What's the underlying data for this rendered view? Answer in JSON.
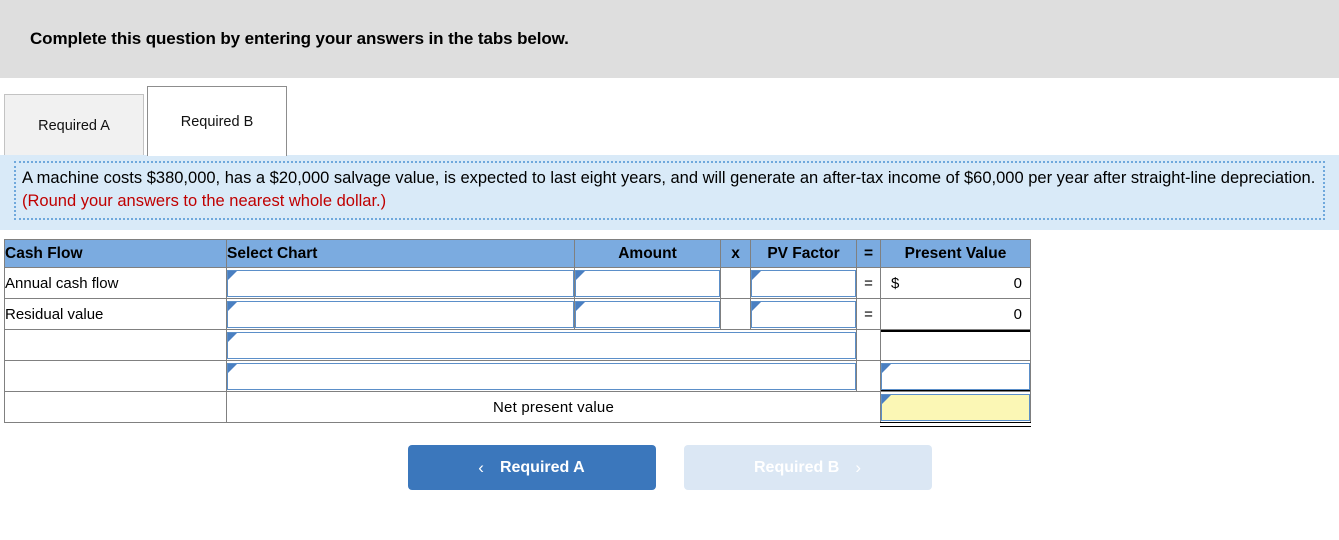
{
  "banner": {
    "instruction": "Complete this question by entering your answers in the tabs below."
  },
  "tabs": [
    {
      "label": "Required A",
      "active": false
    },
    {
      "label": "Required B",
      "active": true
    }
  ],
  "question": {
    "text": "A machine costs $380,000, has a $20,000 salvage value, is expected to last eight years, and will generate an after-tax income of $60,000 per year after straight-line depreciation.",
    "note": "(Round your answers to the nearest whole dollar.)"
  },
  "table": {
    "headers": {
      "cash_flow": "Cash Flow",
      "select_chart": "Select Chart",
      "amount": "Amount",
      "times": "x",
      "pv_factor": "PV Factor",
      "equals": "=",
      "present_value": "Present Value"
    },
    "rows": [
      {
        "cash_flow": "Annual cash flow",
        "select_chart": "",
        "amount": "",
        "times": "",
        "pv_factor": "",
        "equals": "=",
        "pv_currency": "$",
        "present_value": "0"
      },
      {
        "cash_flow": "Residual value",
        "select_chart": "",
        "amount": "",
        "times": "",
        "pv_factor": "",
        "equals": "=",
        "pv_currency": "",
        "present_value": "0"
      },
      {
        "cash_flow": "",
        "select_chart": "",
        "equals": "",
        "present_value": ""
      },
      {
        "cash_flow": "",
        "select_chart": "",
        "equals": "",
        "present_value": ""
      },
      {
        "cash_flow": "",
        "net_present_value_label": "Net present value",
        "equals": "",
        "present_value": ""
      }
    ]
  },
  "nav": {
    "prev": {
      "label": "Required A",
      "chevron": "‹",
      "state": "enabled"
    },
    "next": {
      "label": "Required B",
      "chevron": "›",
      "state": "disabled"
    }
  },
  "colors": {
    "banner_bg": "#dedede",
    "question_bg": "#d9eaf8",
    "header_blue": "#7babe0",
    "button_blue": "#3b77bc",
    "button_disabled": "#dbe7f4",
    "highlight_yellow": "#fbf7b5",
    "note_red": "#c00000"
  }
}
